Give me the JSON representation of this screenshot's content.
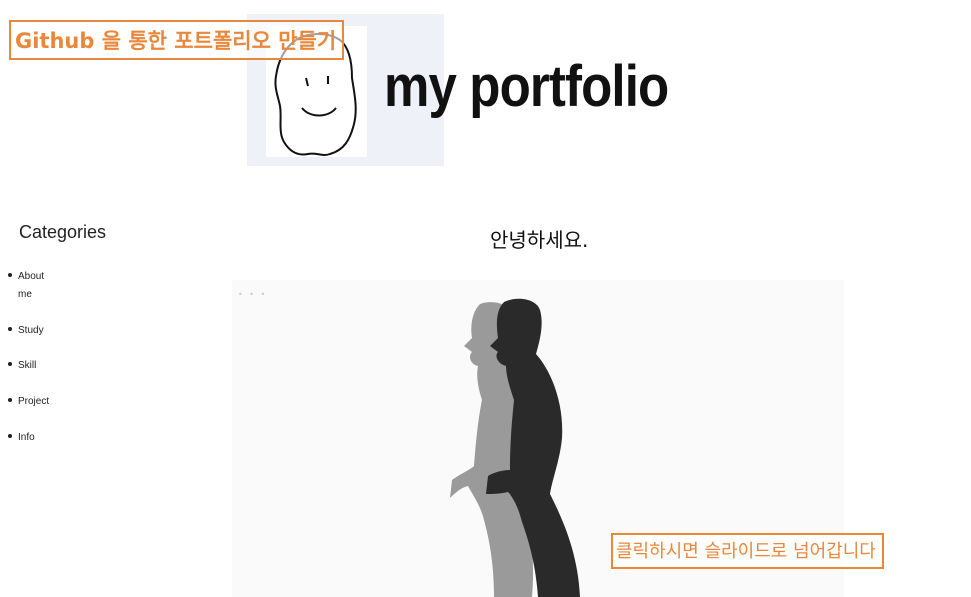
{
  "annotations": {
    "top": "Github 을 통한 포트폴리오 만들기",
    "bottom": "클릭하시면 슬라이드로 넘어갑니다"
  },
  "header": {
    "logo_icon": "smiley-face-drawing",
    "title": "my portfolio"
  },
  "sidebar": {
    "title": "Categories",
    "items": [
      {
        "label": "About me"
      },
      {
        "label": "Study"
      },
      {
        "label": "Skill"
      },
      {
        "label": "Project"
      },
      {
        "label": "Info"
      }
    ]
  },
  "main": {
    "greeting": "안녕하세요.",
    "slide_image": "walking-silhouette",
    "slide_indicator": "• • •"
  },
  "colors": {
    "annotation": "#e9883a",
    "logo_background": "#eef1f8",
    "silhouette_dark": "#2a2a2a",
    "silhouette_light": "#9a9a9a"
  }
}
